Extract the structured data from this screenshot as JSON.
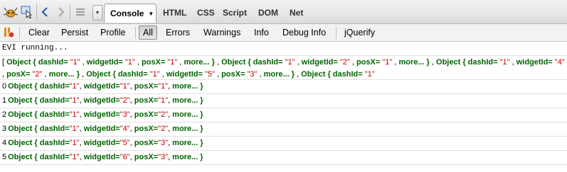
{
  "toolbar": {
    "inspect_icon": "firebug-icon",
    "panels": [
      "Console",
      "HTML",
      "CSS",
      "Script",
      "DOM",
      "Net"
    ],
    "active_panel": "Console"
  },
  "console_toolbar": {
    "buttons": [
      "Clear",
      "Persist",
      "Profile",
      "All",
      "Errors",
      "Warnings",
      "Info",
      "Debug Info",
      "jQuerify"
    ],
    "active_filter": "All"
  },
  "log": {
    "line1": "EVI running...",
    "array_line": [
      {
        "t": "p",
        "v": "[ "
      },
      {
        "t": "k",
        "v": "Object { "
      },
      {
        "t": "k",
        "v": "dashId="
      },
      {
        "t": "s",
        "v": "\"1\""
      },
      {
        "t": "p",
        "v": ", "
      },
      {
        "t": "k",
        "v": "widgetId="
      },
      {
        "t": "s",
        "v": "\"1\""
      },
      {
        "t": "p",
        "v": ", "
      },
      {
        "t": "k",
        "v": "posX="
      },
      {
        "t": "s",
        "v": "\"1\""
      },
      {
        "t": "p",
        "v": ", "
      },
      {
        "t": "k",
        "v": "more... }"
      },
      {
        "t": "p",
        "v": ", "
      },
      {
        "t": "k",
        "v": "Object { "
      },
      {
        "t": "k",
        "v": "dashId="
      },
      {
        "t": "s",
        "v": "\"1\""
      },
      {
        "t": "p",
        "v": ", "
      },
      {
        "t": "k",
        "v": "widgetId="
      },
      {
        "t": "s",
        "v": "\"2\""
      },
      {
        "t": "p",
        "v": ", "
      },
      {
        "t": "k",
        "v": "posX="
      },
      {
        "t": "s",
        "v": "\"1\""
      },
      {
        "t": "p",
        "v": ", "
      },
      {
        "t": "k",
        "v": "more... }"
      },
      {
        "t": "p",
        "v": ", "
      },
      {
        "t": "k",
        "v": "Object { "
      },
      {
        "t": "k",
        "v": "dashId="
      },
      {
        "t": "s",
        "v": "\"1\""
      },
      {
        "t": "p",
        "v": ", "
      },
      {
        "t": "k",
        "v": "widgetId="
      },
      {
        "t": "s",
        "v": "\"4\""
      },
      {
        "t": "p",
        "v": ", "
      },
      {
        "t": "k",
        "v": "posX="
      },
      {
        "t": "s",
        "v": "\"2\""
      },
      {
        "t": "p",
        "v": ", "
      },
      {
        "t": "k",
        "v": "more... }"
      },
      {
        "t": "p",
        "v": ", "
      },
      {
        "t": "k",
        "v": "Object { "
      },
      {
        "t": "k",
        "v": "dashId="
      },
      {
        "t": "s",
        "v": "\"1\""
      },
      {
        "t": "p",
        "v": ", "
      },
      {
        "t": "k",
        "v": "widgetId="
      },
      {
        "t": "s",
        "v": "\"5\""
      },
      {
        "t": "p",
        "v": ", "
      },
      {
        "t": "k",
        "v": "posX="
      },
      {
        "t": "s",
        "v": "\"3\""
      },
      {
        "t": "p",
        "v": ", "
      },
      {
        "t": "k",
        "v": "more... }"
      },
      {
        "t": "p",
        "v": ", "
      },
      {
        "t": "k",
        "v": "Object { "
      },
      {
        "t": "k",
        "v": "dashId="
      },
      {
        "t": "s",
        "v": "\"1\""
      }
    ],
    "items": [
      {
        "index": "0",
        "widgetId": "\"1\"",
        "posX": "\"1\""
      },
      {
        "index": "1",
        "widgetId": "\"2\"",
        "posX": "\"1\""
      },
      {
        "index": "2",
        "widgetId": "\"3\"",
        "posX": "\"2\""
      },
      {
        "index": "3",
        "widgetId": "\"4\"",
        "posX": "\"2\""
      },
      {
        "index": "4",
        "widgetId": "\"5\"",
        "posX": "\"3\""
      },
      {
        "index": "5",
        "widgetId": "\"6\"",
        "posX": "\"3\""
      }
    ],
    "labels": {
      "object_open": "Object { ",
      "dashId": "dashId=",
      "dash_value": "\"1\"",
      "widgetId": "widgetId=",
      "posX": "posX=",
      "more": "more... }",
      "comma": ", "
    }
  },
  "colors": {
    "key": "#006400",
    "string": "#cc0000",
    "toolbar_bg": "#e6e6e6"
  }
}
